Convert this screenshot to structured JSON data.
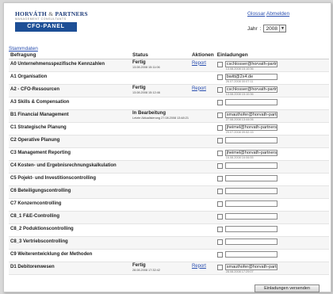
{
  "brand": {
    "name": "HORVÁTH",
    "amp": "&",
    "name2": "PARTNERS",
    "tagline": "MANAGEMENT CONSULTANTS",
    "panel_title": "CFO-PANEL"
  },
  "header_links": {
    "glossar": "Glossar",
    "abmelden": "Abmelden"
  },
  "year": {
    "label": "Jahr",
    "value": "2008"
  },
  "stammdaten": "Stammdaten",
  "columns": [
    "Befragung",
    "Status",
    "Aktionen",
    "Einladungen"
  ],
  "rows": [
    {
      "name": "A0 Unternehmensspezifische Kennzahlen",
      "status": "Fertig",
      "status_sub": "13.08.2008 15:11:06",
      "action": "Report",
      "invite": "cschlosser@horvath-partn",
      "invite_date": "13.08.2008 15:10:36"
    },
    {
      "name": "A1 Organisation",
      "status": "",
      "status_sub": "",
      "action": "",
      "invite": "bwitt@2x4.de",
      "invite_date": "26.07.2008 00:07:11"
    },
    {
      "name": "A2 - CFO-Ressourcen",
      "status": "Fertig",
      "status_sub": "13.08.2008 15:12:46",
      "action": "Report",
      "invite": "cschlosser@horvath-partn",
      "invite_date": "13.08.2008 15:10:36"
    },
    {
      "name": "A3 Skills & Compensation",
      "status": "",
      "status_sub": "",
      "action": "",
      "invite": "",
      "invite_date": ""
    },
    {
      "name": "B1 Financial Management",
      "status": "In Bearbeitung",
      "status_sub": "Letzte Aktualisierung 27.08.2008 13:48:21",
      "action": "",
      "invite": "smauthofer@horvath-partn",
      "invite_date": "27.08.2008 13:44:06"
    },
    {
      "name": "C1 Strategische Planung",
      "status": "",
      "status_sub": "",
      "action": "",
      "invite": "jheimel@horvath-partners.",
      "invite_date": "29.07.2008 09:52:15"
    },
    {
      "name": "C2 Operative Planung",
      "status": "",
      "status_sub": "",
      "action": "",
      "invite": "",
      "invite_date": ""
    },
    {
      "name": "C3 Management Reporting",
      "status": "",
      "status_sub": "",
      "action": "",
      "invite": "jheimel@horvath-partners.",
      "invite_date": "16.08.2008 16:06:55"
    },
    {
      "name": "C4 Kosten- und Ergebnisrechnungskalkulation",
      "status": "",
      "status_sub": "",
      "action": "",
      "invite": "",
      "invite_date": ""
    },
    {
      "name": "C5 Pojekt- und Investitionscontrolling",
      "status": "",
      "status_sub": "",
      "action": "",
      "invite": "",
      "invite_date": ""
    },
    {
      "name": "C6 Beteiligungscontrolling",
      "status": "",
      "status_sub": "",
      "action": "",
      "invite": "",
      "invite_date": ""
    },
    {
      "name": "C7 Konzerncontrolling",
      "status": "",
      "status_sub": "",
      "action": "",
      "invite": "",
      "invite_date": ""
    },
    {
      "name": "C8_1 F&E-Controlling",
      "status": "",
      "status_sub": "",
      "action": "",
      "invite": "",
      "invite_date": ""
    },
    {
      "name": "C8_2 Poduktionscontrolling",
      "status": "",
      "status_sub": "",
      "action": "",
      "invite": "",
      "invite_date": ""
    },
    {
      "name": "C8_3 Vertriebscontrolling",
      "status": "",
      "status_sub": "",
      "action": "",
      "invite": "",
      "invite_date": ""
    },
    {
      "name": "C9 Weiterentwicklung der Methoden",
      "status": "",
      "status_sub": "",
      "action": "",
      "invite": "",
      "invite_date": ""
    },
    {
      "name": "D1 Debitorenwesen",
      "status": "Fertig",
      "status_sub": "28.08.2008 17:32:42",
      "action": "Report",
      "invite": "smauthofer@horvath-partn",
      "invite_date": "28.08.2008 17:29:07"
    }
  ],
  "send_button": "Einladungen versenden"
}
